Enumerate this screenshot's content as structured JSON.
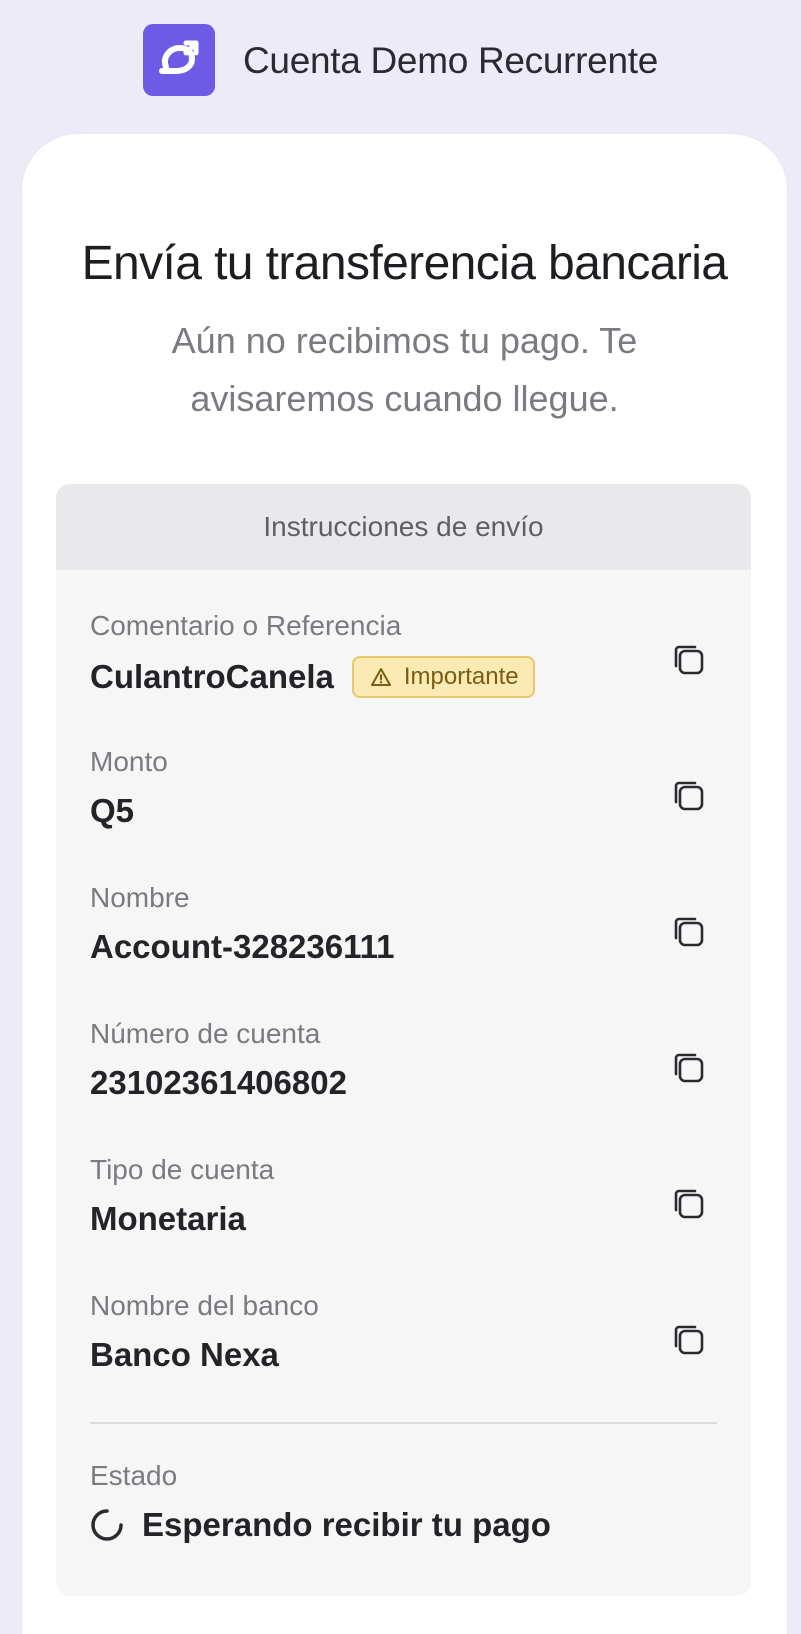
{
  "header": {
    "brand_name": "Cuenta Demo Recurrente"
  },
  "main": {
    "title": "Envía tu transferencia bancaria",
    "subtitle_line1": "Aún no recibimos tu pago. Te",
    "subtitle_line2": "avisaremos cuando llegue."
  },
  "instructions": {
    "heading": "Instrucciones de envío",
    "reference": {
      "label": "Comentario o Referencia",
      "value": "CulantroCanela",
      "badge": "Importante"
    },
    "amount": {
      "label": "Monto",
      "value": "Q5"
    },
    "name": {
      "label": "Nombre",
      "value": "Account-328236111"
    },
    "account_number": {
      "label": "Número de cuenta",
      "value": "23102361406802"
    },
    "account_type": {
      "label": "Tipo de cuenta",
      "value": "Monetaria"
    },
    "bank_name": {
      "label": "Nombre del banco",
      "value": "Banco Nexa"
    },
    "status": {
      "label": "Estado",
      "value": "Esperando recibir tu pago"
    }
  },
  "colors": {
    "brand": "#6d5be6",
    "badge_bg": "#fbeab4",
    "badge_border": "#e6c76b",
    "page_bg": "#ecebf7"
  },
  "icons": {
    "logo": "recurring-arrow-icon",
    "copy": "copy-icon",
    "warning": "warning-icon",
    "status": "spinner-icon"
  }
}
